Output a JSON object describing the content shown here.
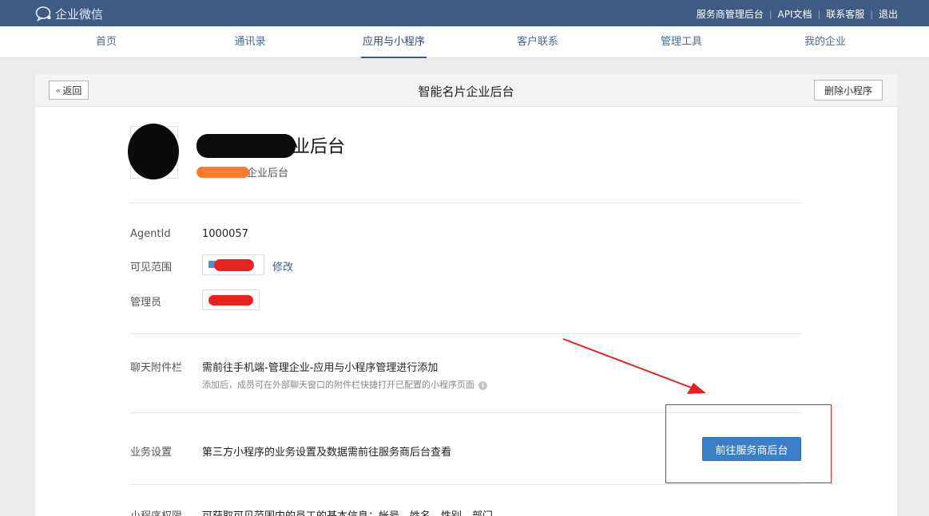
{
  "topbar": {
    "logo_text": "企业微信",
    "links": [
      "服务商管理后台",
      "API文档",
      "联系客服",
      "退出"
    ]
  },
  "nav": {
    "items": [
      "首页",
      "通讯录",
      "应用与小程序",
      "客户联系",
      "管理工具",
      "我的企业"
    ],
    "active": "应用与小程序"
  },
  "panel": {
    "back_label": "返回",
    "title": "智能名片企业后台",
    "delete_label": "删除小程序"
  },
  "app": {
    "name_visible": "业后台",
    "subtitle_visible": "企业后台"
  },
  "details": {
    "agentid_label": "AgentId",
    "agentid_value": "1000057",
    "visible_label": "可见范围",
    "edit_label": "修改",
    "admin_label": "管理员"
  },
  "chat_bar": {
    "label": "聊天附件栏",
    "text": "需前往手机端-管理企业-应用与小程序管理进行添加",
    "hint": "添加后，成员可在外部聊天窗口的附件栏快捷打开已配置的小程序页面"
  },
  "business": {
    "label": "业务设置",
    "text": "第三方小程序的业务设置及数据需前往服务商后台查看",
    "button": "前往服务商后台"
  },
  "permission": {
    "label": "小程序权限",
    "text": "可获取可见范围内的员工的基本信息：帐号、姓名、性别、部门"
  },
  "colors": {
    "topbar": "#3d5b83",
    "primary_button": "#3a7fc8",
    "annotation": "#e22222"
  }
}
